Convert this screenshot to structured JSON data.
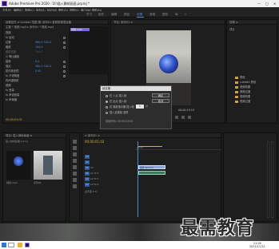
{
  "window": {
    "title": "Adobe Premiere Pro 2020 - D:\\插入静帧画面.prproj *",
    "controls": [
      "—",
      "□",
      "✕"
    ]
  },
  "menu": [
    "文件(F)",
    "编辑(E)",
    "剪辑(C)",
    "序列(S)",
    "标记(M)",
    "图形(G)",
    "视图(V)",
    "窗口(W)",
    "帮助(H)"
  ],
  "workspaces": [
    "学习",
    "组件",
    "编辑",
    "颜色",
    "效果",
    "音频",
    "图形",
    "库",
    "»"
  ],
  "workspace_active": "效果",
  "effect_controls": {
    "tabs": "效果控件 ≡   Lumetri 范围   源: 序列01   音频剪辑混合器",
    "source": "主要 * 视频.mp4 ▸ 序列01 * 视频.mp4",
    "clip_label": "视频.mp4",
    "rows": [
      {
        "label": "视频",
        "value": ""
      },
      {
        "label": "fx  运动",
        "value": ""
      },
      {
        "label": "    位置",
        "value": "960.0  540.0"
      },
      {
        "label": "    缩放",
        "value": "100.0"
      },
      {
        "label": "    缩放宽度",
        "value": "100.0"
      },
      {
        "label": "    ☑ 等比缩放",
        "value": ""
      },
      {
        "label": "    旋转",
        "value": "0.0"
      },
      {
        "label": "    锚点",
        "value": "960.0  540.0"
      },
      {
        "label": "    防闪烁滤镜",
        "value": "0.00"
      },
      {
        "label": "fx  不透明度",
        "value": ""
      },
      {
        "label": "    时间重映射",
        "value": ""
      },
      {
        "label": "音频",
        "value": ""
      },
      {
        "label": "fx  音量",
        "value": ""
      },
      {
        "label": "fx  声道音量",
        "value": ""
      },
      {
        "label": "fx  声像器",
        "value": ""
      }
    ],
    "timecode": "00;00;01;02"
  },
  "monitor": {
    "tab": "节目: 序列01 ≡",
    "timecode": "00;00;15;14"
  },
  "project_right": {
    "tab1": "效果 ≡",
    "tab2": "项目",
    "folders": [
      "预设",
      "Lumetri 预设",
      "音频效果",
      "音频过渡",
      "视频效果",
      "视频过渡"
    ]
  },
  "dialog": {
    "title": "帧定格",
    "options": [
      "在 入点 插入帧",
      "在 出点 插入帧",
      "在 播放指示器 插入帧",
      "插入定格帧 选项"
    ],
    "selected_option": 1,
    "ok": "确定",
    "cancel": "取消",
    "number": "1",
    "number_label": "帧",
    "bottom_label": "持续时间:  00;00;03;00"
  },
  "bin": {
    "tab": "项目: 插入静帧画面 ≡",
    "path": "插入静帧画面.prproj",
    "thumb1_caption": "视频.mp4",
    "thumb2_caption": "序列01"
  },
  "timeline": {
    "tab": "× 序列01 ≡",
    "timecode": "00;00;01;02",
    "ruler_start": "00;00",
    "tracks": [
      {
        "id": "V3",
        "name": ""
      },
      {
        "id": "V2",
        "name": ""
      },
      {
        "id": "V1",
        "name": "V1"
      },
      {
        "id": "A1",
        "name": "A1  M  S"
      },
      {
        "id": "A2",
        "name": "A2  M  S"
      },
      {
        "id": "A3",
        "name": "A3  M  S"
      },
      {
        "id": "主声道",
        "name": "主声道  0.0"
      }
    ],
    "video_clip": "视频.mp4 [V]"
  },
  "taskbar": {
    "time": "11:26",
    "date": "2021/11/12"
  },
  "watermark": "最需教育",
  "colors": {
    "accent": "#4a8ad8",
    "timecode": "#d0b040",
    "video_clip": "#8fa7d8",
    "audio_clip": "#3d7a5c"
  }
}
